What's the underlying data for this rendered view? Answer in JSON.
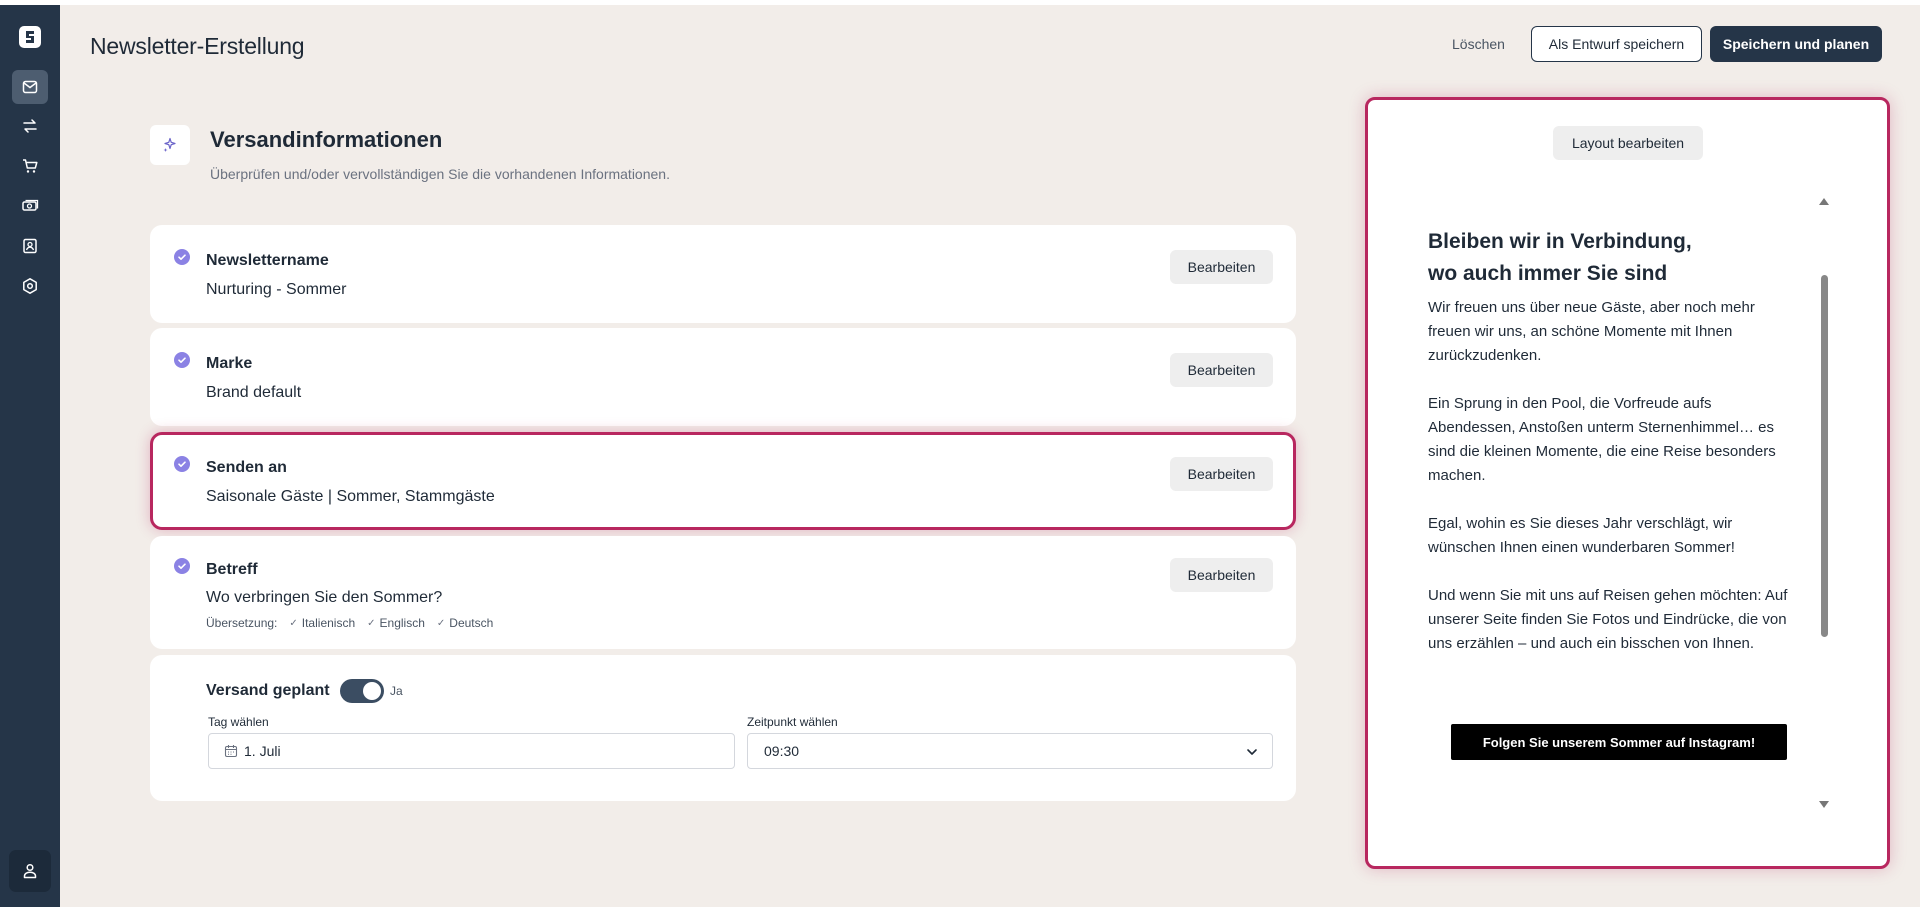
{
  "header": {
    "title": "Newsletter-Erstellung",
    "delete_label": "Löschen",
    "draft_label": "Als Entwurf speichern",
    "save_label": "Speichern und planen"
  },
  "sidebar": {
    "items": [
      {
        "icon": "mail-icon",
        "active": true
      },
      {
        "icon": "transfer-icon",
        "active": false
      },
      {
        "icon": "cart-icon",
        "active": false
      },
      {
        "icon": "money-icon",
        "active": false
      },
      {
        "icon": "contact-icon",
        "active": false
      },
      {
        "icon": "settings-icon",
        "active": false
      }
    ],
    "user_icon": "user-icon"
  },
  "section": {
    "icon": "sparkle-icon",
    "title": "Versandinformationen",
    "subtitle": "Überprüfen und/oder vervollständigen Sie die vorhandenen Informationen."
  },
  "cards": [
    {
      "label": "Newslettername",
      "value": "Nurturing - Sommer",
      "edit_label": "Bearbeiten"
    },
    {
      "label": "Marke",
      "value": "Brand default",
      "edit_label": "Bearbeiten"
    },
    {
      "label": "Senden an",
      "value": "Saisonale Gäste | Sommer, Stammgäste",
      "edit_label": "Bearbeiten",
      "highlighted": true
    },
    {
      "label": "Betreff",
      "value": "Wo verbringen Sie den Sommer?",
      "edit_label": "Bearbeiten",
      "translation_label": "Übersetzung:",
      "translations": [
        "Italienisch",
        "Englisch",
        "Deutsch"
      ]
    }
  ],
  "schedule": {
    "label": "Versand geplant",
    "toggle_on": true,
    "toggle_label": "Ja",
    "day_label": "Tag wählen",
    "day_value": "1. Juli",
    "time_label": "Zeitpunkt wählen",
    "time_value": "09:30"
  },
  "preview": {
    "layout_button": "Layout bearbeiten",
    "title_line1": "Bleiben wir in Verbindung,",
    "title_line2": "wo auch immer Sie sind",
    "paragraphs": [
      "Wir freuen uns über neue Gäste, aber noch mehr freuen wir uns, an schöne Momente mit Ihnen zurückzudenken.",
      "Ein Sprung in den Pool, die Vorfreude aufs Abendessen, Anstoßen unterm Sternenhimmel… es sind die kleinen Momente, die eine Reise besonders machen.",
      "Egal, wohin es Sie dieses Jahr verschlägt, wir wünschen Ihnen einen wunderbaren Sommer!",
      "Und wenn Sie mit uns auf Reisen gehen möchten: Auf unserer Seite finden Sie Fotos und Eindrücke, die von uns erzählen – und auch ein bisschen von Ihnen."
    ],
    "cta": "Folgen Sie unserem Sommer auf Instagram!"
  },
  "colors": {
    "sidebar": "#253548",
    "background": "#f2ede9",
    "highlight": "#b8275f",
    "check": "#8b82e4"
  }
}
